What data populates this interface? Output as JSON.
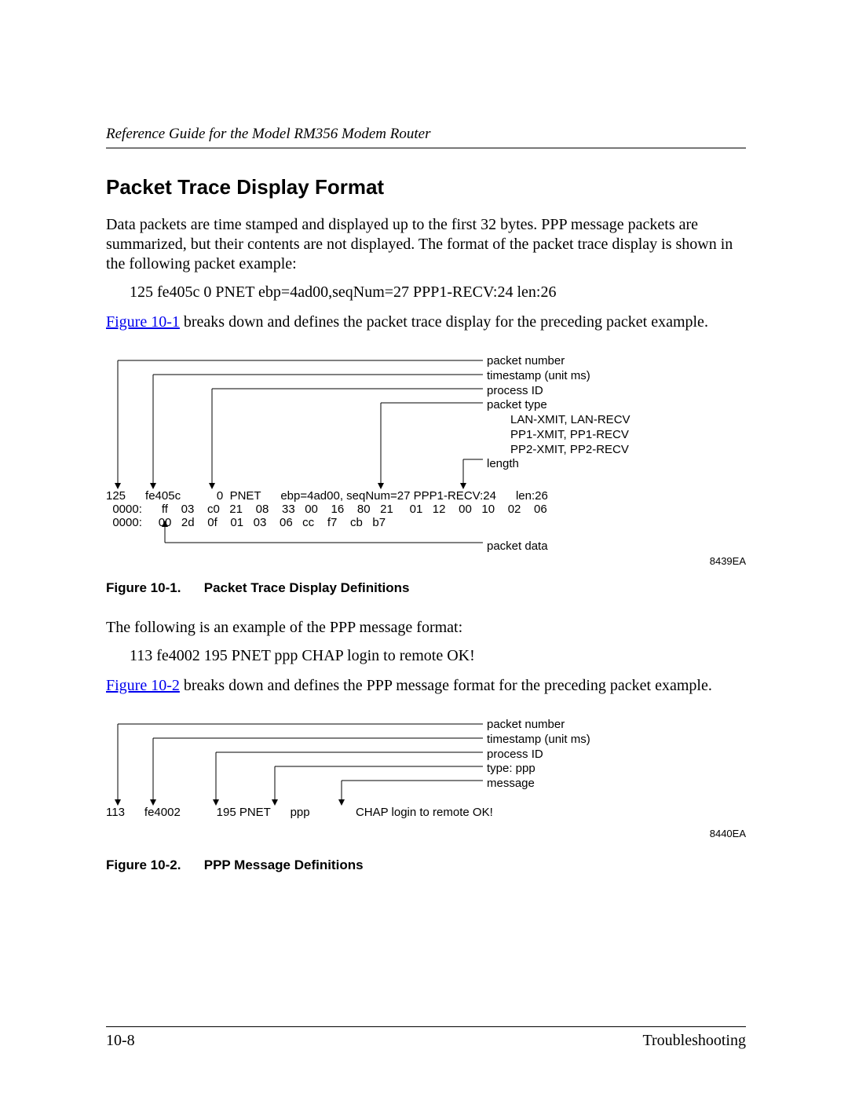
{
  "header": {
    "running": "Reference Guide for the Model RM356 Modem Router"
  },
  "section": {
    "title": "Packet Trace Display Format",
    "para1": "Data packets are time stamped and displayed up to the first 32 bytes. PPP message packets are summarized, but their contents are not displayed. The format of the packet trace display is shown in the following packet example:",
    "example1": "125   fe405c    0 PNET ebp=4ad00,seqNum=27 PPP1-RECV:24 len:26",
    "refline1_a": "Figure 10-1",
    "refline1_b": " breaks down and defines the packet trace display for the preceding packet example.",
    "para_mid": "The following is an example of the PPP message format:",
    "example2": "113   fe4002  195 PNET  ppp CHAP login to remote OK!",
    "refline2_a": "Figure 10-2",
    "refline2_b": " breaks down and defines the PPP message format for the preceding packet example."
  },
  "figure1": {
    "labels": {
      "l1": "packet number",
      "l2": "timestamp (unit ms)",
      "l3": "process ID",
      "l4": "packet type",
      "l4a": "LAN-XMIT, LAN-RECV",
      "l4b": "PP1-XMIT, PP1-RECV",
      "l4c": "PP2-XMIT, PP2-RECV",
      "l5": "length",
      "l6": "packet data"
    },
    "trace": {
      "line1": "125      fe405c           0  PNET      ebp=4ad00, seqNum=27 PPP1-RECV:24      len:26",
      "line2": "  0000:      ff    03    c0   21    08    33   00    16    80   21     01   12    00   10    02    06",
      "line3": "  0000:     00   2d    0f    01   03    06   cc    f7    cb   b7"
    },
    "code": "8439EA",
    "caption_num": "Figure 10-1.",
    "caption_text": "Packet Trace Display Definitions"
  },
  "figure2": {
    "labels": {
      "l1": "packet number",
      "l2": "timestamp (unit ms)",
      "l3": "process ID",
      "l4": "type: ppp",
      "l5": "message"
    },
    "trace": {
      "line1": "113      fe4002           195 PNET      ppp              CHAP login to remote OK!"
    },
    "code": "8440EA",
    "caption_num": "Figure 10-2.",
    "caption_text": "PPP Message Definitions"
  },
  "footer": {
    "page": "10-8",
    "chapter": "Troubleshooting"
  }
}
